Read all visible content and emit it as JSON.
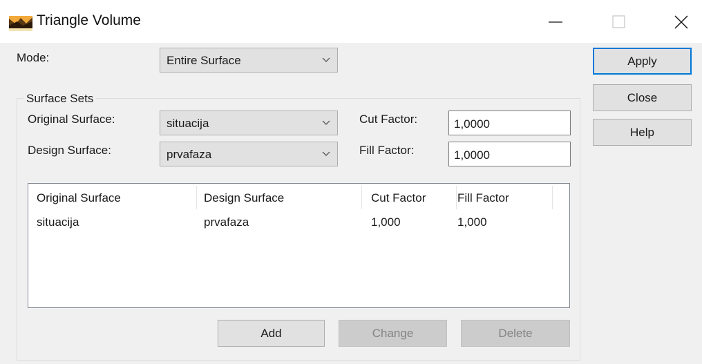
{
  "window": {
    "title": "Triangle Volume",
    "controls": [
      "minimize",
      "maximize",
      "close"
    ]
  },
  "mode": {
    "label": "Mode:",
    "selected": "Entire Surface"
  },
  "surface_sets": {
    "title": "Surface Sets",
    "original_label": "Original Surface:",
    "original_selected": "situacija",
    "design_label": "Design Surface:",
    "design_selected": "prvafaza",
    "cut_label": "Cut Factor:",
    "cut_value": "1,0000",
    "fill_label": "Fill Factor:",
    "fill_value": "1,0000"
  },
  "table": {
    "headers": [
      "Original Surface",
      "Design Surface",
      "Cut Factor",
      "Fill Factor"
    ],
    "rows": [
      [
        "situacija",
        "prvafaza",
        "1,000",
        "1,000"
      ]
    ]
  },
  "buttons": {
    "apply": "Apply",
    "close": "Close",
    "help": "Help",
    "add": "Add",
    "change": "Change",
    "delete": "Delete"
  },
  "colors": {
    "primary_border": "#0078d7",
    "button_face": "#e1e1e1",
    "disabled_face": "#cccccc",
    "window_bg": "#f0f0f0"
  },
  "icons": {
    "app": "triangle-surface-icon",
    "dropdown": "chevron-down-icon"
  }
}
